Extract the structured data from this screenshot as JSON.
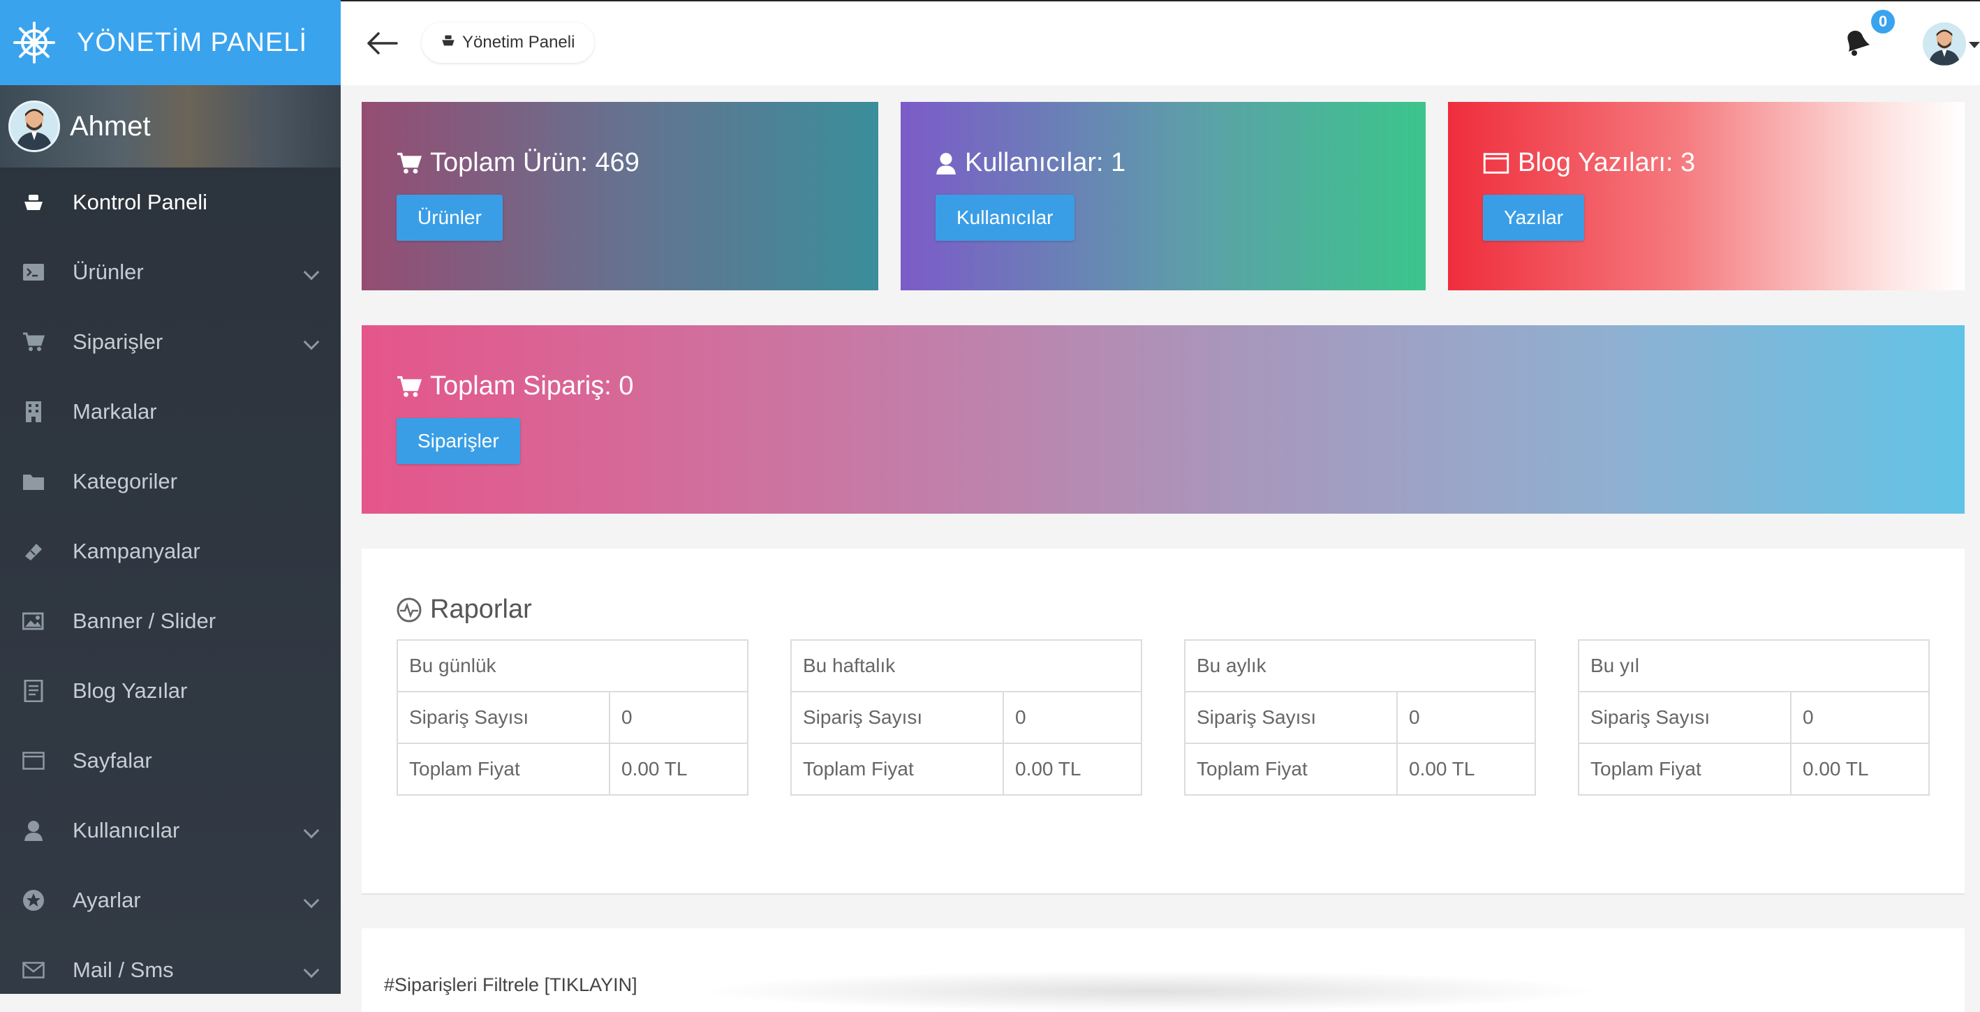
{
  "sidebar": {
    "brand": "YÖNETİM PANELİ",
    "user_name": "Ahmet",
    "items": [
      {
        "label": "Kontrol Paneli",
        "icon": "ship-icon",
        "active": true
      },
      {
        "label": "Ürünler",
        "icon": "terminal-icon",
        "expandable": true
      },
      {
        "label": "Siparişler",
        "icon": "cart-icon",
        "expandable": true
      },
      {
        "label": "Markalar",
        "icon": "building-icon"
      },
      {
        "label": "Kategoriler",
        "icon": "folder-icon"
      },
      {
        "label": "Kampanyalar",
        "icon": "ticket-icon"
      },
      {
        "label": "Banner / Slider",
        "icon": "image-icon"
      },
      {
        "label": "Blog Yazılar",
        "icon": "document-icon"
      },
      {
        "label": "Sayfalar",
        "icon": "window-icon"
      },
      {
        "label": "Kullanıcılar",
        "icon": "user-icon",
        "expandable": true
      },
      {
        "label": "Ayarlar",
        "icon": "star-circle-icon",
        "expandable": true
      },
      {
        "label": "Mail / Sms",
        "icon": "envelope-icon",
        "expandable": true
      }
    ]
  },
  "topbar": {
    "breadcrumb": "Yönetim Paneli",
    "notification_count": "0"
  },
  "cards": {
    "products": {
      "title": "Toplam Ürün: 469",
      "button": "Ürünler"
    },
    "users": {
      "title": "Kullanıcılar: 1",
      "button": "Kullanıcılar"
    },
    "blog": {
      "title": "Blog Yazıları: 3",
      "button": "Yazılar"
    },
    "orders": {
      "title": "Toplam Sipariş: 0",
      "button": "Siparişler"
    }
  },
  "reports": {
    "title": "Raporlar",
    "tables": [
      {
        "period": "Bu günlük",
        "rows": [
          {
            "key": "Sipariş Sayısı",
            "value": "0"
          },
          {
            "key": "Toplam Fiyat",
            "value": "0.00 TL"
          }
        ]
      },
      {
        "period": "Bu haftalık",
        "rows": [
          {
            "key": "Sipariş Sayısı",
            "value": "0"
          },
          {
            "key": "Toplam Fiyat",
            "value": "0.00 TL"
          }
        ]
      },
      {
        "period": "Bu aylık",
        "rows": [
          {
            "key": "Sipariş Sayısı",
            "value": "0"
          },
          {
            "key": "Toplam Fiyat",
            "value": "0.00 TL"
          }
        ]
      },
      {
        "period": "Bu yıl",
        "rows": [
          {
            "key": "Sipariş Sayısı",
            "value": "0"
          },
          {
            "key": "Toplam Fiyat",
            "value": "0.00 TL"
          }
        ]
      }
    ]
  },
  "filter": {
    "label": "#Siparişleri Filtrele [TIKLAYIN]"
  },
  "colors": {
    "brand": "#3aa3ee",
    "sidebar": "#2b323b",
    "button": "#3a9ee6"
  }
}
